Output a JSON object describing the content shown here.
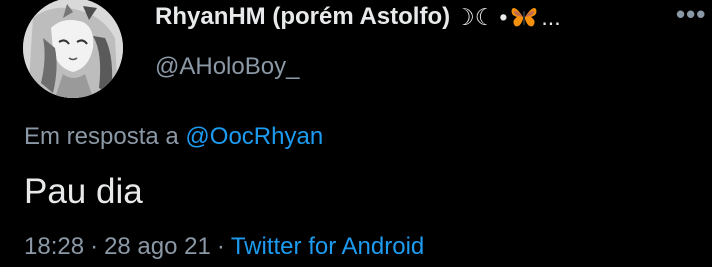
{
  "user": {
    "display_name": "RhyanHM (porém Astolfo)",
    "name_emoji_moon": "☽☾",
    "name_bullet": "•",
    "name_ellipsis": "...",
    "handle": "@AHoloBoy_",
    "avatar_icon": "anime-avatar-icon",
    "butterfly_icon": "butterfly-icon"
  },
  "reply": {
    "prefix": "Em resposta a",
    "to_handle": "@OocRhyan"
  },
  "tweet": {
    "text": "Pau dia"
  },
  "meta": {
    "time": "18:28",
    "separator": "·",
    "date": "28 ago 21",
    "source": "Twitter for Android"
  },
  "more_button_label": "•••",
  "colors": {
    "background": "#000000",
    "primary_text": "#e7e9ea",
    "secondary_text": "#8b98a5",
    "link": "#1d9bf0",
    "butterfly": "#f4900c"
  }
}
